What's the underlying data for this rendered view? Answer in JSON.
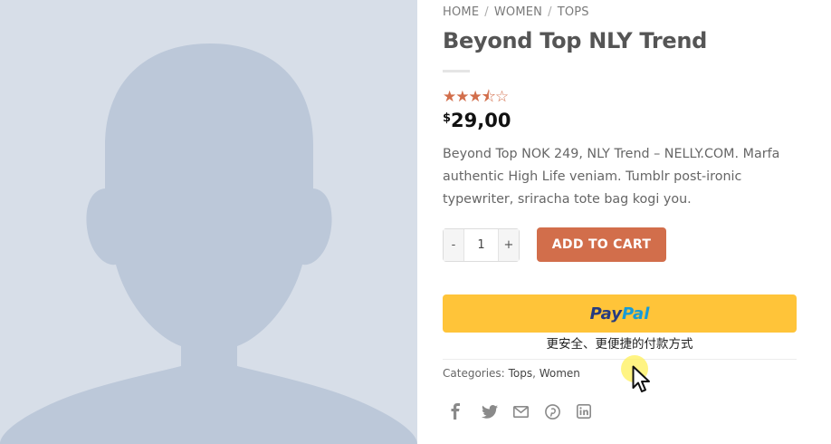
{
  "breadcrumb": {
    "items": [
      "HOME",
      "WOMEN",
      "TOPS"
    ],
    "separator": "/"
  },
  "product": {
    "title": "Beyond Top NLY Trend",
    "rating": 3.5,
    "rating_max": 5,
    "stars_display": "★★★⯪☆",
    "currency_symbol": "$",
    "price": "29,00",
    "description": "Beyond Top NOK 249, NLY Trend – NELLY.COM. Marfa authentic High Life veniam. Tumblr post-ironic typewriter, sriracha tote bag kogi you.",
    "quantity": "1",
    "qty_minus": "-",
    "qty_plus": "+",
    "add_to_cart_label": "ADD TO CART"
  },
  "paypal": {
    "brand_pay": "Pay",
    "brand_pal": "Pal",
    "tagline": "更安全、更便捷的付款方式"
  },
  "categories": {
    "label": "Categories:",
    "items": [
      "Tops",
      "Women"
    ],
    "separator": ","
  },
  "share": {
    "icons": [
      "facebook-icon",
      "twitter-icon",
      "email-icon",
      "pinterest-icon",
      "linkedin-icon"
    ]
  },
  "colors": {
    "accent": "#d26e4b",
    "paypal_yellow": "#ffc439",
    "paypal_dark_blue": "#253b80",
    "paypal_light_blue": "#179bd7",
    "placeholder_bg": "#d7dee8",
    "placeholder_figure": "#bcc8d9"
  }
}
